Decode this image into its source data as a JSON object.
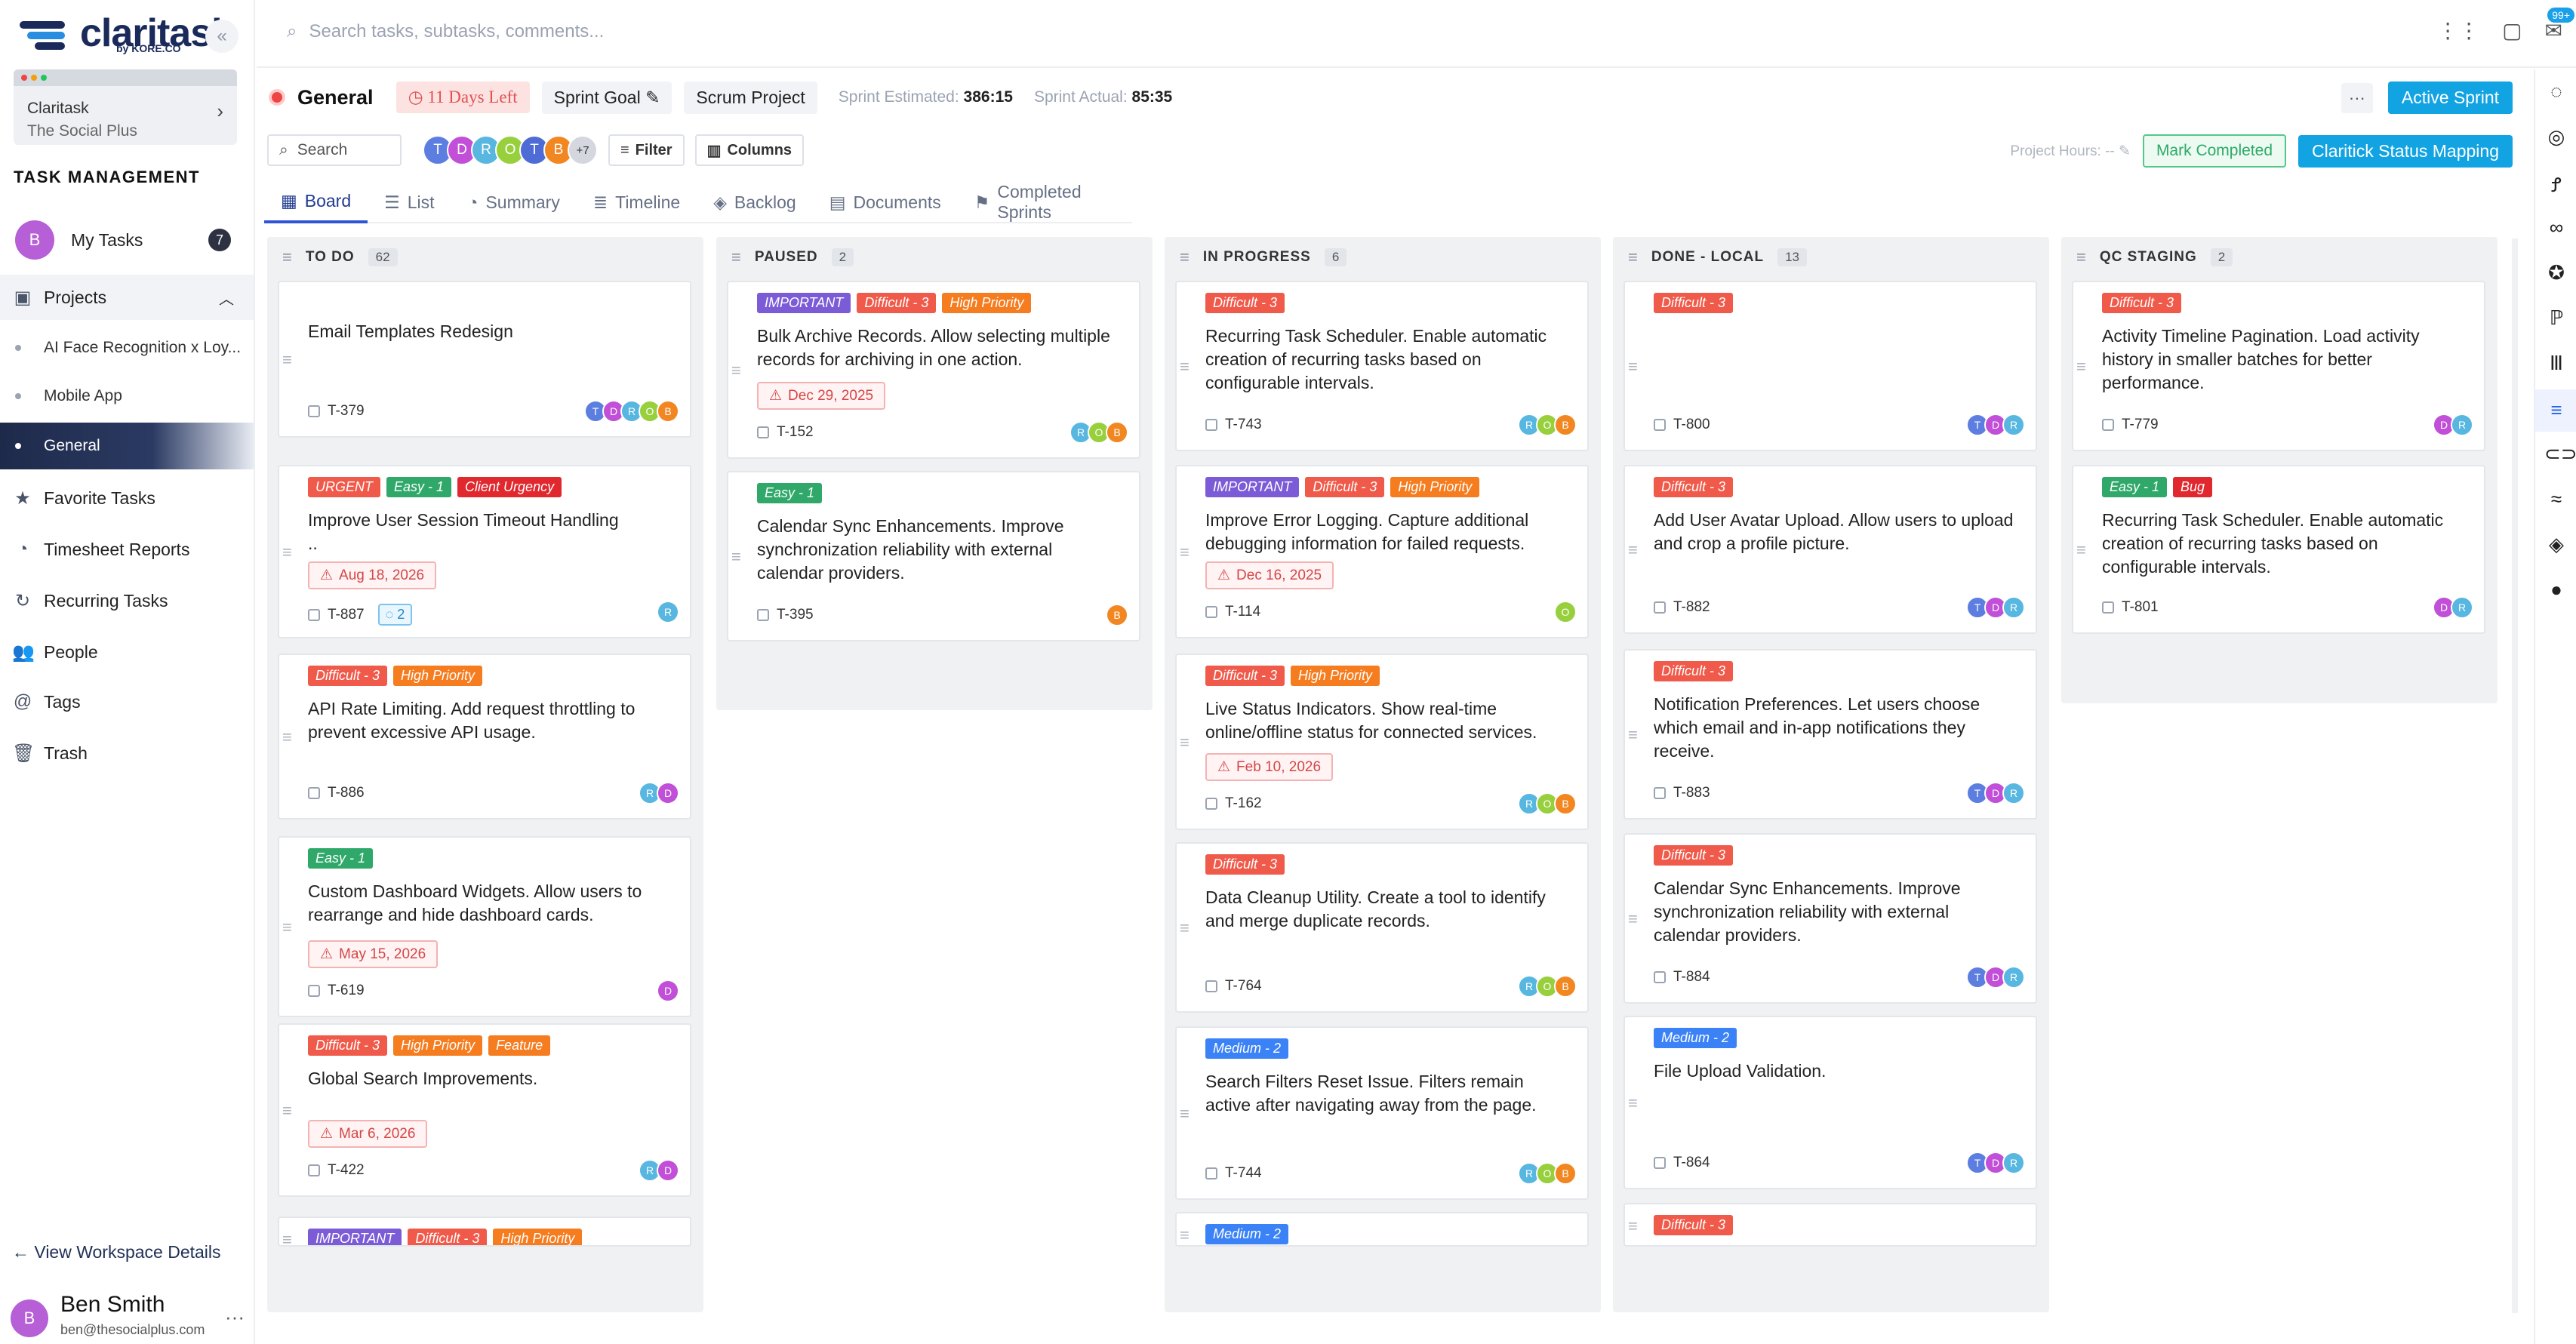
{
  "app": {
    "logo_text": "claritask",
    "logo_sub": "by KORE.CO",
    "search_placeholder": "Search tasks, subtasks, comments...",
    "notif_badge": "99+"
  },
  "sidebar": {
    "workspace": {
      "name": "Claritask",
      "sub": "The Social Plus"
    },
    "section_title": "TASK MANAGEMENT",
    "my_tasks": {
      "avatar": "B",
      "label": "My Tasks",
      "count": "7"
    },
    "projects_label": "Projects",
    "projects": [
      {
        "label": "AI Face Recognition x Loy..."
      },
      {
        "label": "Mobile App"
      },
      {
        "label": "General"
      }
    ],
    "items": [
      {
        "label": "Favorite Tasks",
        "icon": "star-icon"
      },
      {
        "label": "Timesheet Reports",
        "icon": "pie-icon"
      },
      {
        "label": "Recurring Tasks",
        "icon": "refresh-icon"
      },
      {
        "label": "People",
        "icon": "people-icon"
      },
      {
        "label": "Tags",
        "icon": "at-icon"
      },
      {
        "label": "Trash",
        "icon": "trash-icon"
      }
    ],
    "workspace_link": "← View Workspace Details",
    "user": {
      "avatar": "B",
      "name": "Ben Smith",
      "email": "ben@thesocialplus.com"
    }
  },
  "project": {
    "title": "General",
    "days_left": "11 Days Left",
    "sprint_goal": "Sprint Goal",
    "scrum": "Scrum Project",
    "estimated_label": "Sprint Estimated:",
    "estimated_value": "386:15",
    "actual_label": "Sprint Actual:",
    "actual_value": "85:35",
    "more": "···",
    "active_sprint": "Active Sprint"
  },
  "toolbar": {
    "search": "Search",
    "avatars": [
      "T",
      "D",
      "R",
      "O",
      "T",
      "B"
    ],
    "avatars_more": "+7",
    "filter": "Filter",
    "columns": "Columns",
    "project_hours": "Project Hours: --",
    "mark_completed": "Mark Completed",
    "status_mapping": "Claritick Status Mapping"
  },
  "tabs": [
    {
      "label": "Board"
    },
    {
      "label": "List"
    },
    {
      "label": "Summary"
    },
    {
      "label": "Timeline"
    },
    {
      "label": "Backlog"
    },
    {
      "label": "Documents"
    },
    {
      "label": "Completed Sprints"
    }
  ],
  "colors": {
    "important": "#7c5cd6",
    "difficult": "#f05a4a",
    "high": "#f57c1f",
    "urgent": "#f05a4a",
    "easy": "#2fa86a",
    "client": "#e0282e",
    "feature": "#f57c1f",
    "medium": "#3b82f6",
    "bug": "#e0282e"
  },
  "columns": [
    {
      "title": "TO DO",
      "count": "62",
      "cards": [
        {
          "tags": [],
          "title": "Email Templates Redesign",
          "due": "",
          "id": "T-379",
          "comments": "",
          "avatars": [
            "T",
            "D",
            "R",
            "O",
            "B"
          ]
        },
        {
          "tags": [
            {
              "t": "URGENT",
              "c": "urgent"
            },
            {
              "t": "Easy - 1",
              "c": "easy"
            },
            {
              "t": "Client Urgency",
              "c": "client"
            }
          ],
          "title": "Improve User Session Timeout Handling",
          "title2": "..",
          "due": "Aug 18, 2026",
          "id": "T-887",
          "comments": "2",
          "avatars": [
            "R"
          ]
        },
        {
          "tags": [
            {
              "t": "Difficult - 3",
              "c": "difficult"
            },
            {
              "t": "High Priority",
              "c": "high"
            }
          ],
          "title": "API Rate Limiting. Add request throttling to prevent excessive API usage.",
          "due": "",
          "id": "T-886",
          "comments": "",
          "avatars": [
            "R",
            "D"
          ]
        },
        {
          "tags": [
            {
              "t": "Easy - 1",
              "c": "easy"
            }
          ],
          "title": "Custom Dashboard Widgets. Allow users to rearrange and hide dashboard cards.",
          "due": "May 15, 2026",
          "id": "T-619",
          "comments": "",
          "avatars": [
            "D"
          ]
        },
        {
          "tags": [
            {
              "t": "Difficult - 3",
              "c": "difficult"
            },
            {
              "t": "High Priority",
              "c": "high"
            },
            {
              "t": "Feature",
              "c": "feature"
            }
          ],
          "title": "Global Search Improvements.",
          "due": "Mar 6, 2026",
          "id": "T-422",
          "comments": "",
          "avatars": [
            "R",
            "D"
          ]
        },
        {
          "tags": [
            {
              "t": "IMPORTANT",
              "c": "important"
            },
            {
              "t": "Difficult - 3",
              "c": "difficult"
            },
            {
              "t": "High Priority",
              "c": "high"
            }
          ],
          "title": "",
          "due": "",
          "id": "",
          "comments": "",
          "avatars": []
        }
      ]
    },
    {
      "title": "PAUSED",
      "count": "2",
      "cards": [
        {
          "tags": [
            {
              "t": "IMPORTANT",
              "c": "important"
            },
            {
              "t": "Difficult - 3",
              "c": "difficult"
            },
            {
              "t": "High Priority",
              "c": "high"
            }
          ],
          "title": "Bulk Archive Records. Allow selecting multiple records for archiving in one action.",
          "due": "Dec 29, 2025",
          "id": "T-152",
          "comments": "",
          "avatars": [
            "R",
            "O",
            "B"
          ]
        },
        {
          "tags": [
            {
              "t": "Easy - 1",
              "c": "easy"
            }
          ],
          "title": "Calendar Sync Enhancements. Improve synchronization reliability with external calendar providers.",
          "due": "",
          "id": "T-395",
          "comments": "",
          "avatars": [
            "B"
          ]
        }
      ]
    },
    {
      "title": "IN PROGRESS",
      "count": "6",
      "cards": [
        {
          "tags": [
            {
              "t": "Difficult - 3",
              "c": "difficult"
            }
          ],
          "title": "Recurring Task Scheduler. Enable automatic creation of recurring tasks based on configurable intervals.",
          "due": "",
          "id": "T-743",
          "comments": "",
          "avatars": [
            "R",
            "O",
            "B"
          ]
        },
        {
          "tags": [
            {
              "t": "IMPORTANT",
              "c": "important"
            },
            {
              "t": "Difficult - 3",
              "c": "difficult"
            },
            {
              "t": "High Priority",
              "c": "high"
            }
          ],
          "title": "Improve Error Logging. Capture additional debugging information for failed requests.",
          "due": "Dec 16, 2025",
          "id": "T-114",
          "comments": "",
          "avatars": [
            "O"
          ]
        },
        {
          "tags": [
            {
              "t": "Difficult - 3",
              "c": "difficult"
            },
            {
              "t": "High Priority",
              "c": "high"
            }
          ],
          "title": "Live Status Indicators. Show real-time online/offline status for connected services.",
          "due": "Feb 10, 2026",
          "id": "T-162",
          "comments": "",
          "avatars": [
            "R",
            "O",
            "B"
          ]
        },
        {
          "tags": [
            {
              "t": "Difficult - 3",
              "c": "difficult"
            }
          ],
          "title": "Data Cleanup Utility. Create a tool to identify and merge duplicate records.",
          "due": "",
          "id": "T-764",
          "comments": "",
          "avatars": [
            "R",
            "O",
            "B"
          ]
        },
        {
          "tags": [
            {
              "t": "Medium - 2",
              "c": "medium"
            }
          ],
          "title": "Search Filters Reset Issue. Filters remain active after navigating away from the page.",
          "due": "",
          "id": "T-744",
          "comments": "",
          "avatars": [
            "R",
            "O",
            "B"
          ]
        },
        {
          "tags": [
            {
              "t": "Medium - 2",
              "c": "medium"
            }
          ],
          "title": "",
          "due": "",
          "id": "",
          "comments": "",
          "avatars": []
        }
      ]
    },
    {
      "title": "DONE - LOCAL",
      "count": "13",
      "cards": [
        {
          "tags": [
            {
              "t": "Difficult - 3",
              "c": "difficult"
            }
          ],
          "title": "",
          "due": "",
          "id": "T-800",
          "comments": "",
          "avatars": [
            "T",
            "D",
            "R"
          ]
        },
        {
          "tags": [
            {
              "t": "Difficult - 3",
              "c": "difficult"
            }
          ],
          "title": "Add User Avatar Upload. Allow users to upload and crop a profile picture.",
          "due": "",
          "id": "T-882",
          "comments": "",
          "avatars": [
            "T",
            "D",
            "R"
          ]
        },
        {
          "tags": [
            {
              "t": "Difficult - 3",
              "c": "difficult"
            }
          ],
          "title": "Notification Preferences. Let users choose which email and in-app notifications they receive.",
          "due": "",
          "id": "T-883",
          "comments": "",
          "avatars": [
            "T",
            "D",
            "R"
          ]
        },
        {
          "tags": [
            {
              "t": "Difficult - 3",
              "c": "difficult"
            }
          ],
          "title": "Calendar Sync Enhancements. Improve synchronization reliability with external calendar providers.",
          "due": "",
          "id": "T-884",
          "comments": "",
          "avatars": [
            "T",
            "D",
            "R"
          ]
        },
        {
          "tags": [
            {
              "t": "Medium - 2",
              "c": "medium"
            }
          ],
          "title": "File Upload Validation.",
          "due": "",
          "id": "T-864",
          "comments": "",
          "avatars": [
            "T",
            "D",
            "R"
          ]
        },
        {
          "tags": [
            {
              "t": "Difficult - 3",
              "c": "difficult"
            }
          ],
          "title": "",
          "due": "",
          "id": "",
          "comments": "",
          "avatars": []
        }
      ]
    },
    {
      "title": "QC STAGING",
      "count": "2",
      "cards": [
        {
          "tags": [
            {
              "t": "Difficult - 3",
              "c": "difficult"
            }
          ],
          "title": "Activity Timeline Pagination. Load activity history in smaller batches for better performance.",
          "due": "",
          "id": "T-779",
          "comments": "",
          "avatars": [
            "D",
            "R"
          ]
        },
        {
          "tags": [
            {
              "t": "Easy - 1",
              "c": "easy"
            },
            {
              "t": "Bug",
              "c": "bug"
            }
          ],
          "title": "Recurring Task Scheduler. Enable automatic creation of recurring tasks based on configurable intervals.",
          "due": "",
          "id": "T-801",
          "comments": "",
          "avatars": [
            "D",
            "R"
          ]
        }
      ]
    }
  ],
  "avatar_colors": {
    "T": "#5b7ee0",
    "D": "#c14fd8",
    "R": "#58b7e0",
    "O": "#97cf3d",
    "B": "#f28722"
  }
}
